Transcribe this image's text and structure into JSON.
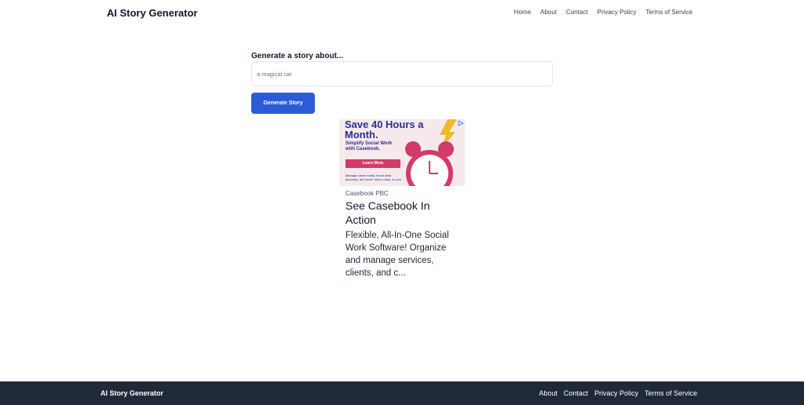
{
  "header": {
    "brand": "AI Story Generator",
    "nav": [
      "Home",
      "About",
      "Contact",
      "Privacy Policy",
      "Terms of Service"
    ]
  },
  "form": {
    "label": "Generate a story about...",
    "input_placeholder": "a magical cat",
    "input_value": "",
    "button_label": "Generate Story",
    "button_color": "#2b5bd7"
  },
  "ad": {
    "banner_headline": "Save 40 Hours a Month.",
    "banner_sub": "Simplify Social Work with Casebook.",
    "banner_cta": "Learn More",
    "banner_fine": "Manage cases easily, boost data accuracy, and never miss a step, so you",
    "advertiser": "Casebook PBC",
    "title": "See Casebook In Action",
    "description": "Flexible, All-In-One Social Work Software! Organize and manage services, clients, and c...",
    "icons": [
      "ad-choices-icon",
      "alarm-clock-icon",
      "lightning-bolt-icon"
    ]
  },
  "footer": {
    "brand": "AI Story Generator",
    "nav": [
      "About",
      "Contact",
      "Privacy Policy",
      "Terms of Service"
    ],
    "background": "#1f2937"
  }
}
